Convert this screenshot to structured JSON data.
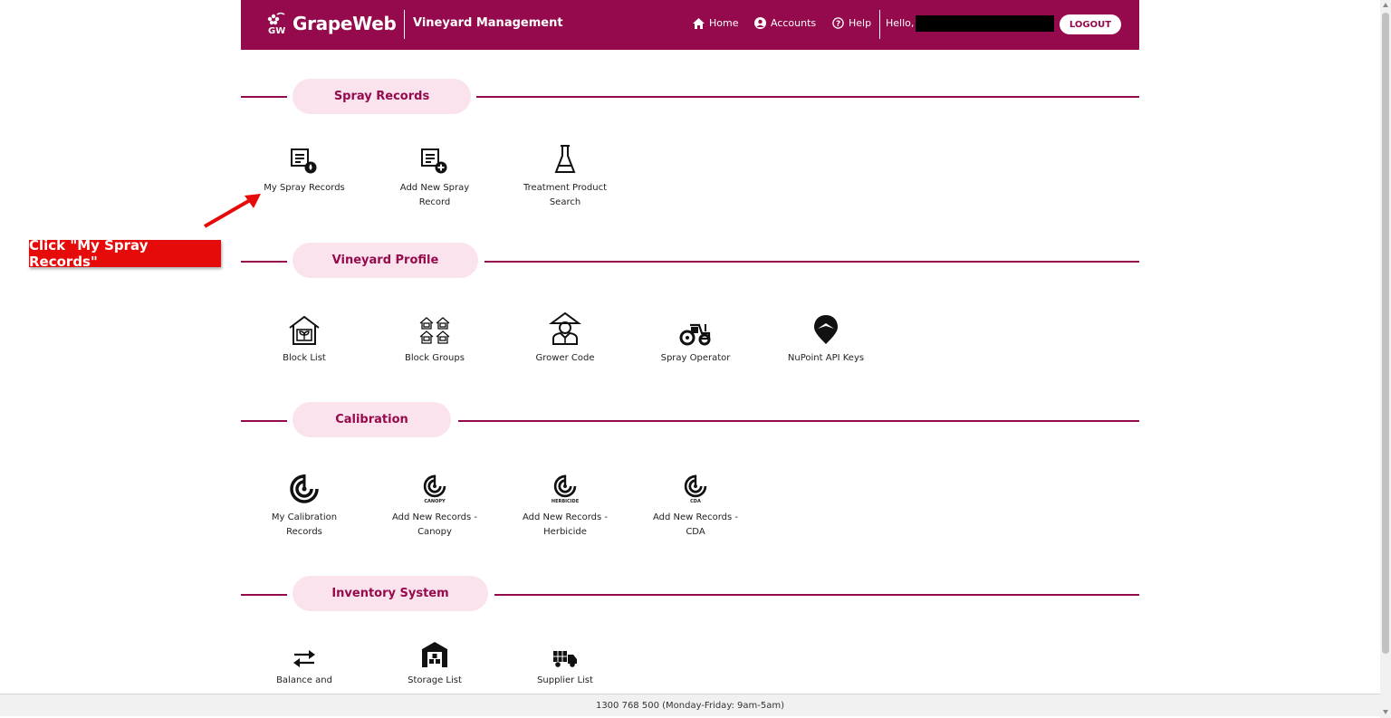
{
  "header": {
    "brand": "GrapeWeb",
    "app_title": "Vineyard Management",
    "nav": {
      "home": "Home",
      "accounts": "Accounts",
      "help": "Help"
    },
    "hello": "Hello, I",
    "logout": "LOGOUT"
  },
  "callout": {
    "text": "Click \"My Spray Records\""
  },
  "sections": {
    "spray": {
      "title": "Spray Records",
      "items": [
        "My Spray Records",
        "Add New Spray Record",
        "Treatment Product Search"
      ]
    },
    "vineyard": {
      "title": "Vineyard Profile",
      "items": [
        "Block List",
        "Block Groups",
        "Grower Code",
        "Spray Operator",
        "NuPoint API Keys"
      ]
    },
    "calibration": {
      "title": "Calibration",
      "items": [
        "My Calibration Records",
        "Add New Records - Canopy",
        "Add New Records - Herbicide",
        "Add New Records - CDA"
      ],
      "icon_captions": [
        "CANOPY",
        "HERBICIDE",
        "CDA"
      ]
    },
    "inventory": {
      "title": "Inventory System",
      "items": [
        "Balance and",
        "Storage List",
        "Supplier List"
      ]
    }
  },
  "footer": {
    "text": "1300 768 500 (Monday-Friday: 9am-5am)"
  },
  "colors": {
    "brand": "#950a4c",
    "pill_bg": "#fbe3ee",
    "callout": "#e60b0b"
  }
}
